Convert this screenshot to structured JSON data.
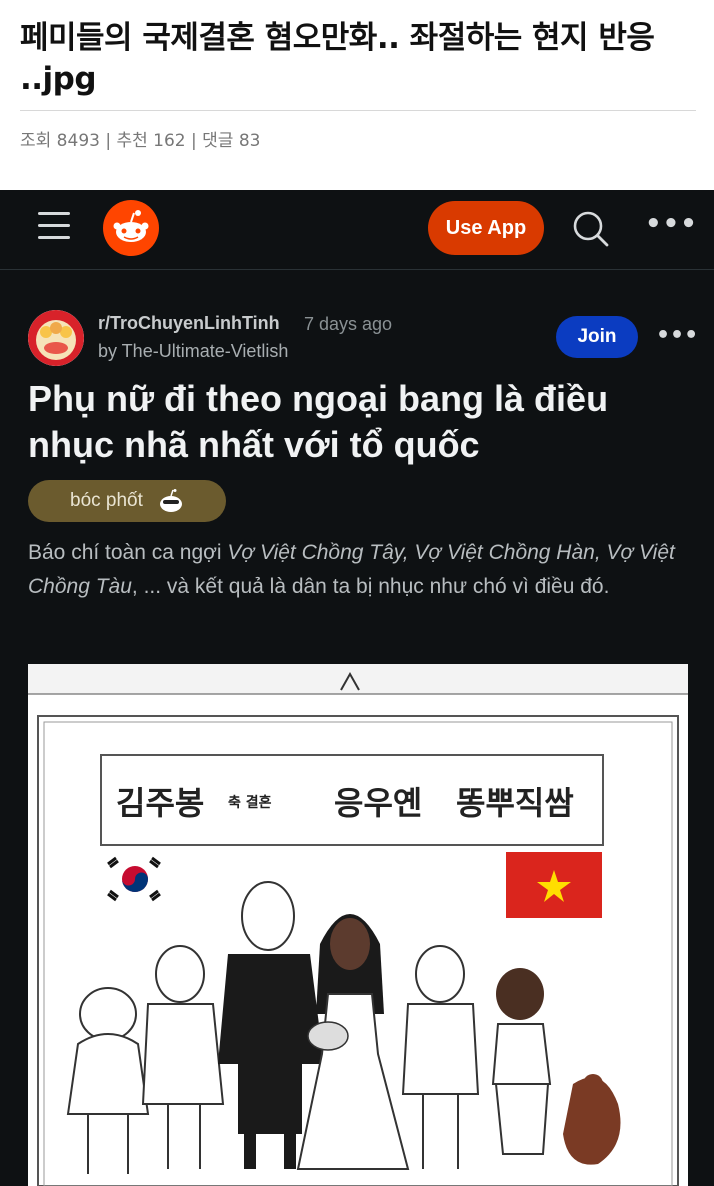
{
  "article": {
    "title": "페미들의 국제결혼 혐오만화.. 좌절하는 현지 반응 ..jpg",
    "meta": "조회 8493 | 추천 162 | 댓글 83"
  },
  "reddit": {
    "nav": {
      "use_app_label": "Use App",
      "more_label": "•••"
    },
    "post": {
      "subreddit": "r/TroChuyenLinhTinh",
      "time": "7 days ago",
      "author": "by The-Ultimate-Vietlish",
      "join_label": "Join",
      "more_label": "•••",
      "title": "Phụ nữ đi theo ngoại bang là điều nhục nhã nhất với tổ quốc",
      "flair": "bóc phốt",
      "body_intro": "Báo chí toàn ca ngợi ",
      "body_italic": "Vợ Việt Chồng Tây, Vợ Việt Chồng Hàn, Vợ Việt Chồng Tàu",
      "body_rest": ", ... và kết quả là dân ta bị nhục như chó vì điều đó."
    },
    "comic": {
      "groom_name": "김주봉",
      "mid_text": "축 결혼",
      "bride_name": "응우옌",
      "flower_text": "똥뿌직쌈"
    }
  },
  "colors": {
    "reddit_bg": "#0e1113",
    "use_app": "#d93a00",
    "join": "#0b3cc1",
    "flair": "#6b5b2e",
    "vn_flag_red": "#da251d",
    "vn_flag_star": "#ffde00"
  },
  "icons": [
    "menu-icon",
    "reddit-logo-icon",
    "search-icon",
    "more-icon",
    "snoo-flair-icon"
  ]
}
